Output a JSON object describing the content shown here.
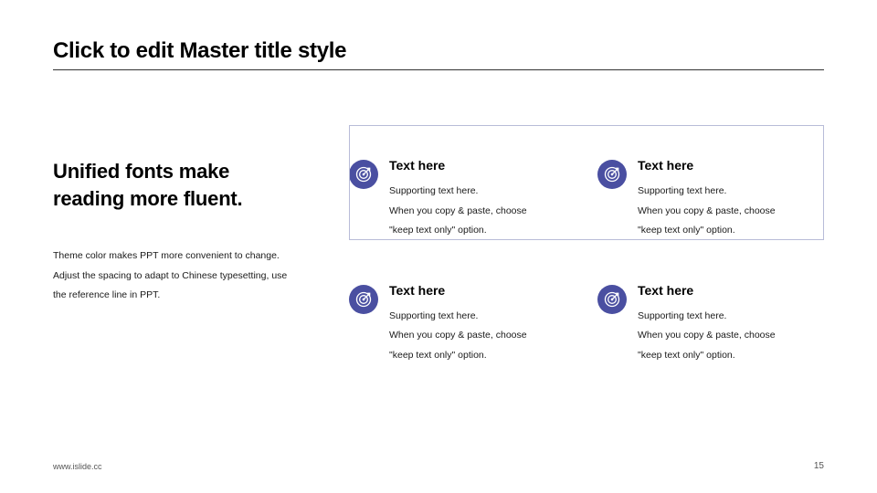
{
  "title": "Click to edit Master title style",
  "left": {
    "heading_l1": "Unified fonts make",
    "heading_l2": "reading more fluent.",
    "body_l1": "Theme color makes PPT more convenient to change.",
    "body_l2": "Adjust the spacing to adapt to Chinese typesetting, use",
    "body_l3": "the reference line in PPT."
  },
  "cards": [
    {
      "title": "Text here",
      "l1": "Supporting text here.",
      "l2": "When you copy & paste, choose",
      "l3": "\"keep text only\" option."
    },
    {
      "title": "Text here",
      "l1": "Supporting text here.",
      "l2": "When you copy & paste, choose",
      "l3": "\"keep text only\" option."
    },
    {
      "title": "Text here",
      "l1": "Supporting text here.",
      "l2": "When you copy & paste, choose",
      "l3": "\"keep text only\" option."
    },
    {
      "title": "Text here",
      "l1": "Supporting text here.",
      "l2": "When you copy & paste, choose",
      "l3": "\"keep text only\" option."
    }
  ],
  "footer": "www.islide.cc",
  "page": "15"
}
